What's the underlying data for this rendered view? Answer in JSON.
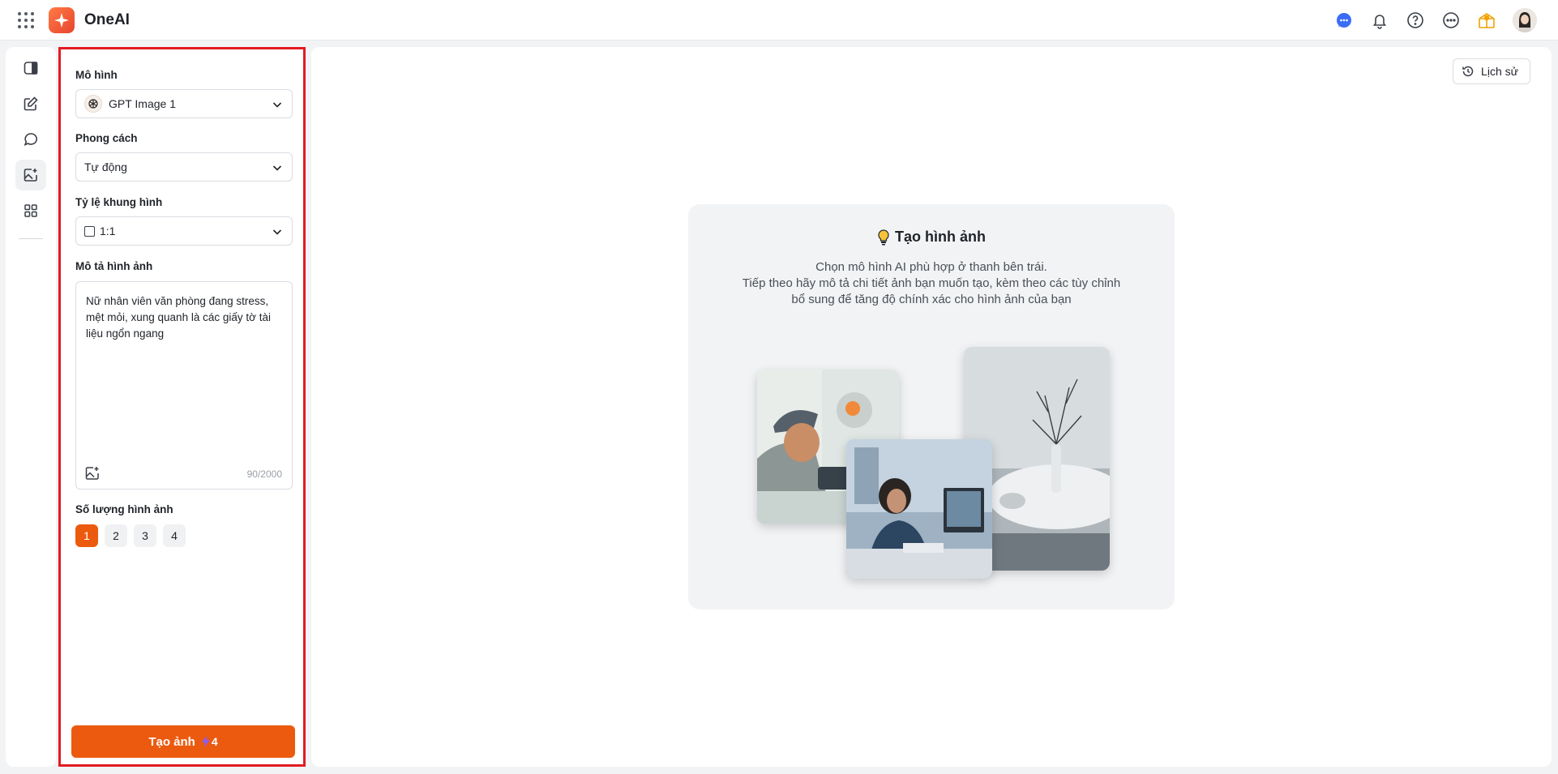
{
  "app": {
    "brand": "OneAI"
  },
  "panel": {
    "model_label": "Mô hình",
    "model_value": "GPT Image 1",
    "style_label": "Phong cách",
    "style_value": "Tự động",
    "ratio_label": "Tỷ lệ khung hình",
    "ratio_value": "1:1",
    "desc_label": "Mô tả hình ảnh",
    "desc_value": "Nữ nhân viên văn phòng đang stress, mệt mỏi, xung quanh là các giấy tờ tài liệu ngổn ngang",
    "char_count": "90/2000",
    "count_label": "Số lượng hình ảnh",
    "count_options": [
      "1",
      "2",
      "3",
      "4"
    ],
    "count_selected": "1",
    "generate_label": "Tạo ảnh",
    "generate_cost": "4"
  },
  "main": {
    "history_label": "Lịch sử",
    "empty_title": "Tạo hình ảnh",
    "empty_lines": [
      "Chọn mô hình AI phù hợp ở thanh bên trái.",
      "Tiếp theo hãy mô tả chi tiết ảnh bạn muốn tạo, kèm theo các tùy chỉnh",
      "bổ sung để tăng độ chính xác cho hình ảnh của bạn"
    ]
  },
  "colors": {
    "accent": "#ec5a0f",
    "highlight_border": "#e31b23"
  },
  "icons": {
    "top": [
      "apps-grid-icon",
      "chat-bubble-icon",
      "bell-icon",
      "help-icon",
      "more-icon",
      "gift-icon"
    ],
    "rail": [
      "sidebar-toggle-icon",
      "edit-icon",
      "chat-icon",
      "image-add-icon",
      "apps-icon"
    ]
  }
}
